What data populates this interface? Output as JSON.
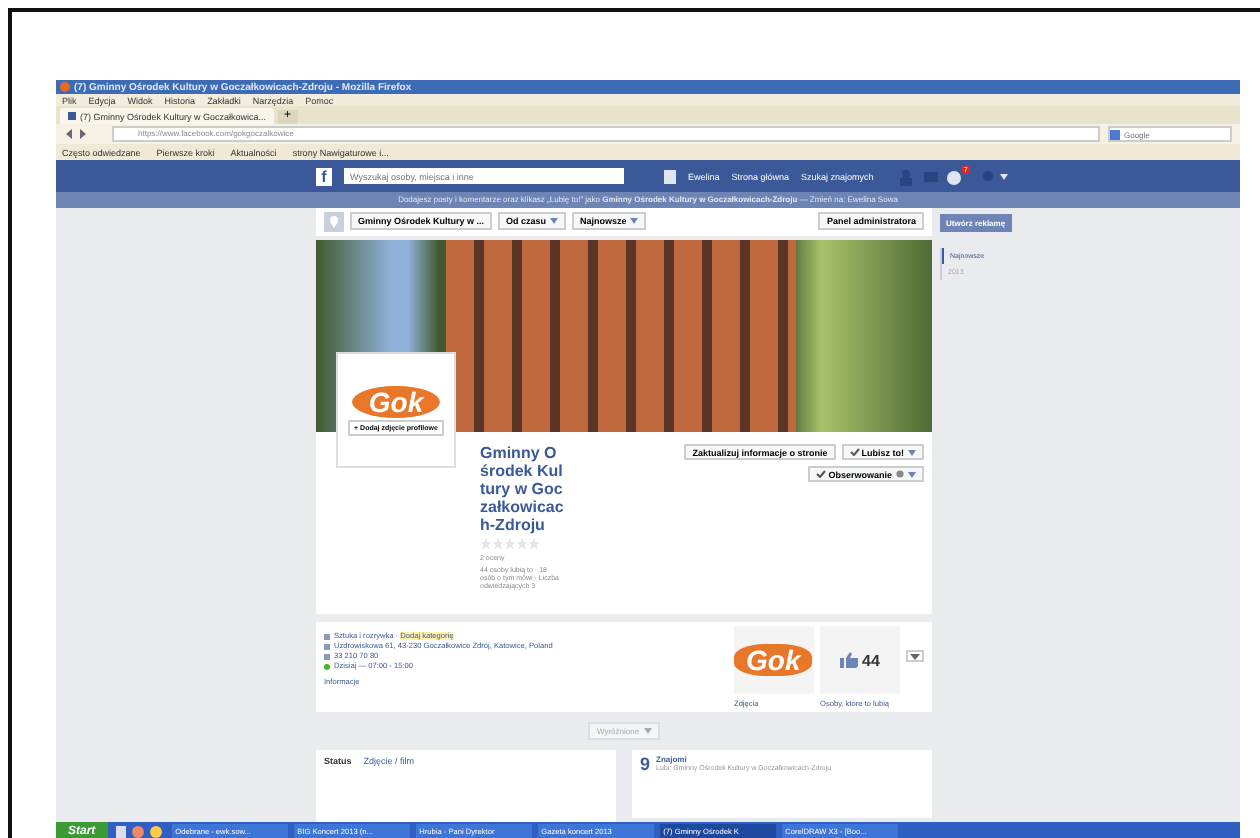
{
  "browser": {
    "title": "(7) Gminny Ośrodek Kultury w Goczałkowicach-Zdroju - Mozilla Firefox",
    "menu": [
      "Plik",
      "Edycja",
      "Widok",
      "Historia",
      "Zakładki",
      "Narzędzia",
      "Pomoc"
    ],
    "tabs": [
      {
        "label": "(7) Gminny Ośrodek Kultury w Goczałkowica...",
        "selected": true
      }
    ],
    "new_tab": "+",
    "url": "https://www.facebook.com/gokgoczalkowice",
    "search_placeholder": "Google",
    "bookmarks": [
      "Często odwiedzane",
      "Pierwsze kroki",
      "Aktualności",
      "strony Nawigaturowe i..."
    ]
  },
  "facebook_bar": {
    "logo": "f",
    "search_placeholder": "Wyszukaj osoby, miejsca i inne",
    "links": [
      "Ewelina",
      "Strona główna",
      "Szukaj znajomych"
    ],
    "notification_count": "7"
  },
  "notice": "Dodajesz posty i komentarze oraz klikasz „Lubię to!” jako **Gminny Ośrodek Kultury w Goczałkowicach-Zdroju** — Zmień na: Ewelina Sowa",
  "toolbar": {
    "filters": [
      "Gminny Ośrodek Kultury w ...",
      "Od czasu",
      "Najnowsze"
    ],
    "admin_button": "Panel administratora"
  },
  "sidebar": {
    "ad_button": "Utwórz reklamę",
    "timeline": [
      {
        "label": "Najnowsze",
        "selected": true
      },
      {
        "label": "2013",
        "selected": false
      }
    ]
  },
  "page": {
    "add_photo": "+ Dodaj zdjęcie profilowe",
    "logo": "Gok",
    "name": "Gminny Ośrodek Kultury w Goczałkowicach-Zdroju",
    "stars": 0,
    "ratings": "2 oceny",
    "stats": "44 osoby lubią to · 18 osób o tym mówi · Liczba odwiedzających 3",
    "buttons": [
      {
        "label": "Zaktualizuj informacje o stronie",
        "checked": false
      },
      {
        "label": "Lubisz to!",
        "checked": true
      },
      {
        "label": "Obserwowanie",
        "checked": true
      }
    ]
  },
  "info": {
    "lines": [
      {
        "kind": "category",
        "text": "Sztuka i rozrywka · ",
        "link": "Dodaj kategorię"
      },
      {
        "kind": "address",
        "text": "Uzdrowiskowa 61, 43-230 Goczałkowice Zdrój, Katowice, Poland"
      },
      {
        "kind": "phone",
        "text": "33 210 70 80"
      },
      {
        "kind": "hours",
        "text": "Dzisiaj — 07:00 - 15:00"
      }
    ],
    "info_link": "Informacje",
    "thumb_logo": "Gok",
    "photos_label": "Zdjęcia",
    "likes_count": "44",
    "likes_label": "Osoby, które to lubią"
  },
  "featured": "Wyróżnione",
  "composer": {
    "tabs": [
      "Status",
      "Zdjęcie / film"
    ]
  },
  "friends": {
    "count": "9",
    "title": "Znajomi",
    "text": "Lubi: Gminny Ośrodek Kultury w Goczałkowicach-Zdroju"
  },
  "taskbar": {
    "start": "Start",
    "items": [
      {
        "label": "Odebrane - ewk.sow...",
        "selected": false
      },
      {
        "label": "BIG Koncert 2013 (n...",
        "selected": false
      },
      {
        "label": "Hrubia - Pani Dyrektor",
        "selected": false
      },
      {
        "label": "Gazeta koncert 2013",
        "selected": false
      },
      {
        "label": "(7) Gminny Ośrodek K",
        "selected": true
      },
      {
        "label": "CorelDRAW X3 - [Boo...",
        "selected": false
      }
    ]
  }
}
